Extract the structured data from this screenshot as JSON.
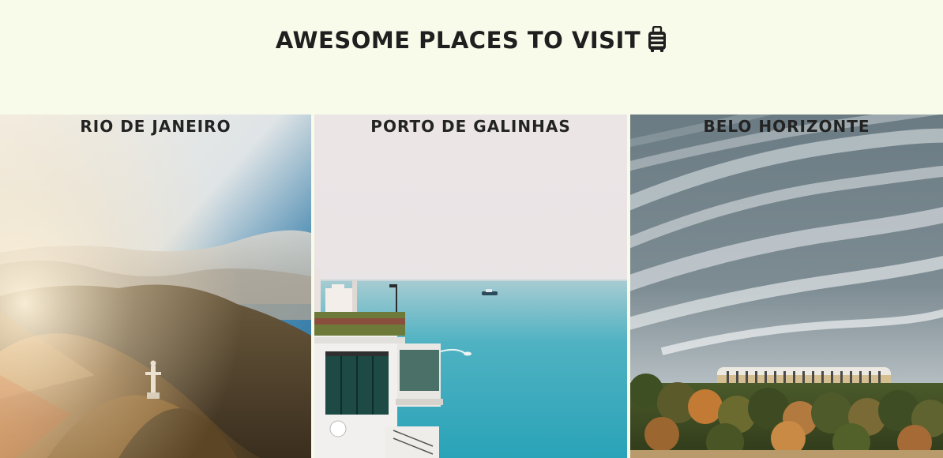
{
  "page": {
    "heading": "AWESOME PLACES TO VISIT",
    "heading_icon": "luggage-icon",
    "background": "#f8fbe9"
  },
  "places": [
    {
      "title": "RIO DE JANEIRO",
      "image": "christ-the-redeemer-mountains-photo"
    },
    {
      "title": "PORTO DE GALINHAS",
      "image": "coastal-building-ocean-boat-photo"
    },
    {
      "title": "BELO HORIZONTE",
      "image": "stadium-cloudy-sky-photo"
    }
  ]
}
